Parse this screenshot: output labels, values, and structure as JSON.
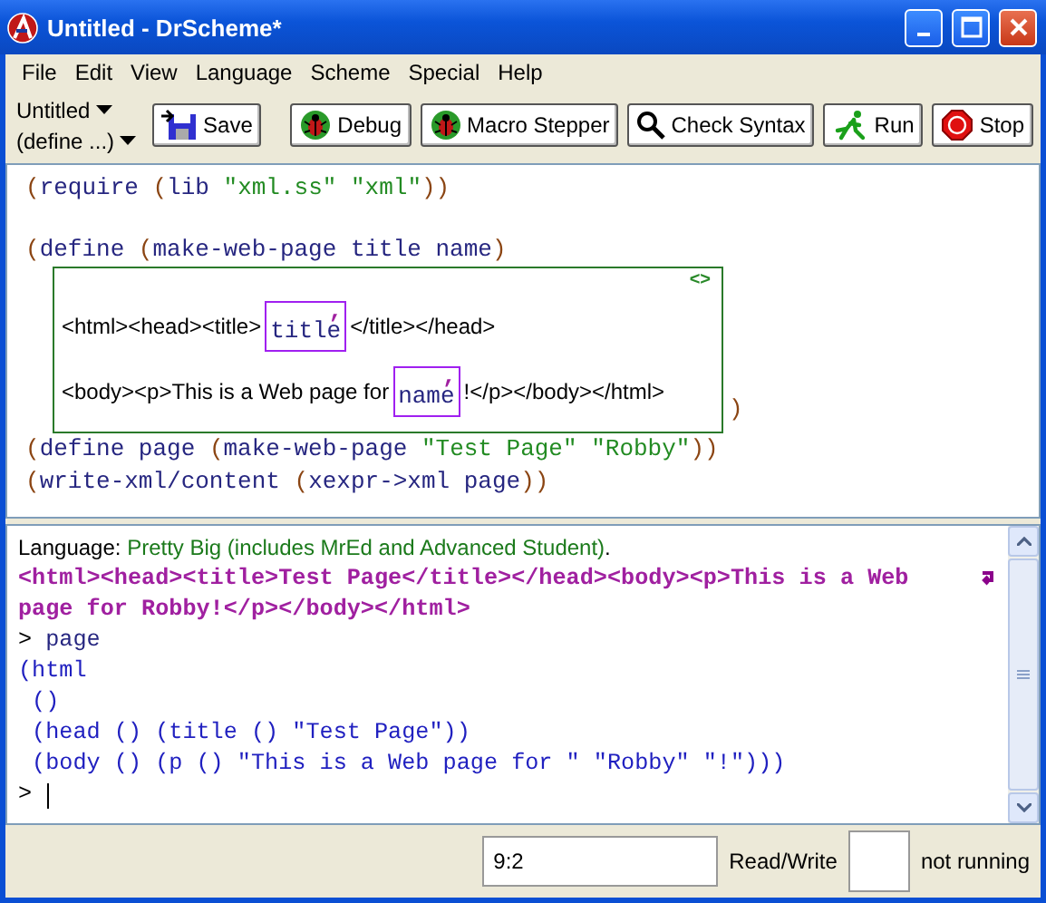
{
  "window": {
    "title": "Untitled - DrScheme*"
  },
  "menu": [
    "File",
    "Edit",
    "View",
    "Language",
    "Scheme",
    "Special",
    "Help"
  ],
  "toolbar": {
    "file_menu": "Untitled",
    "define_menu": "(define ...)",
    "buttons": [
      {
        "kind": "save",
        "label": "Save"
      },
      {
        "kind": "debug",
        "label": "Debug"
      },
      {
        "kind": "stepper",
        "label": "Macro Stepper"
      },
      {
        "kind": "check",
        "label": "Check Syntax"
      },
      {
        "kind": "run",
        "label": "Run"
      },
      {
        "kind": "stop",
        "label": "Stop"
      }
    ]
  },
  "editor": {
    "lines": [
      {
        "kind": "code",
        "tokens": [
          {
            "kind": "p",
            "text": "("
          },
          {
            "kind": "id",
            "text": "require "
          },
          {
            "kind": "p",
            "text": "("
          },
          {
            "kind": "id",
            "text": "lib "
          },
          {
            "kind": "str",
            "text": "\"xml.ss\" "
          },
          {
            "kind": "str",
            "text": "\"xml\""
          },
          {
            "kind": "p",
            "text": "))"
          }
        ]
      },
      {
        "kind": "blank"
      },
      {
        "kind": "code",
        "tokens": [
          {
            "kind": "p",
            "text": "("
          },
          {
            "kind": "id",
            "text": "define "
          },
          {
            "kind": "p",
            "text": "("
          },
          {
            "kind": "id",
            "text": "make-web-page title name"
          },
          {
            "kind": "p",
            "text": ")"
          }
        ]
      },
      {
        "kind": "xml_box",
        "marker": "<>",
        "close": ")",
        "rows": [
          {
            "before": "<html><head><title>",
            "hole": {
              "mark": ",",
              "text": "title"
            },
            "after": "</title></head>"
          },
          {
            "before": "<body><p>This is a Web page for",
            "hole": {
              "mark": ",",
              "text": "name"
            },
            "after": "!</p></body></html>"
          }
        ]
      },
      {
        "kind": "code",
        "tokens": [
          {
            "kind": "p",
            "text": "("
          },
          {
            "kind": "id",
            "text": "define page "
          },
          {
            "kind": "p",
            "text": "("
          },
          {
            "kind": "id",
            "text": "make-web-page "
          },
          {
            "kind": "str",
            "text": "\"Test Page\" "
          },
          {
            "kind": "str",
            "text": "\"Robby\""
          },
          {
            "kind": "p",
            "text": "))"
          }
        ]
      },
      {
        "kind": "code",
        "tokens": [
          {
            "kind": "p",
            "text": "("
          },
          {
            "kind": "id",
            "text": "write-xml/content "
          },
          {
            "kind": "p",
            "text": "("
          },
          {
            "kind": "id",
            "text": "xexpr->xml page"
          },
          {
            "kind": "p",
            "text": "))"
          }
        ]
      }
    ]
  },
  "interactions": {
    "lines": [
      {
        "tokens": [
          {
            "kind": "plain",
            "text": "Language: "
          },
          {
            "kind": "lang",
            "text": "Pretty Big (includes MrEd and Advanced Student)"
          },
          {
            "kind": "plain",
            "text": "."
          }
        ]
      },
      {
        "wrapped": true,
        "tokens": [
          {
            "kind": "out",
            "text": "<html><head><title>Test Page</title></head><body><p>This is a Web"
          }
        ]
      },
      {
        "tokens": [
          {
            "kind": "out",
            "text": "page for Robby!</p></body></html>"
          }
        ]
      },
      {
        "tokens": [
          {
            "kind": "plain",
            "text": "> "
          },
          {
            "kind": "id",
            "text": "page"
          }
        ]
      },
      {
        "tokens": [
          {
            "kind": "result",
            "text": "(html"
          }
        ]
      },
      {
        "tokens": [
          {
            "kind": "result",
            "text": " ()"
          }
        ]
      },
      {
        "tokens": [
          {
            "kind": "result",
            "text": " (head () (title () \"Test Page\"))"
          }
        ]
      },
      {
        "tokens": [
          {
            "kind": "result",
            "text": " (body () (p () \"This is a Web page for \" \"Robby\" \"!\")))"
          }
        ]
      },
      {
        "cursor": true,
        "tokens": [
          {
            "kind": "plain",
            "text": ">"
          }
        ]
      }
    ]
  },
  "status_bar": {
    "position": "9:2",
    "mode": "Read/Write",
    "state": "not running"
  }
}
